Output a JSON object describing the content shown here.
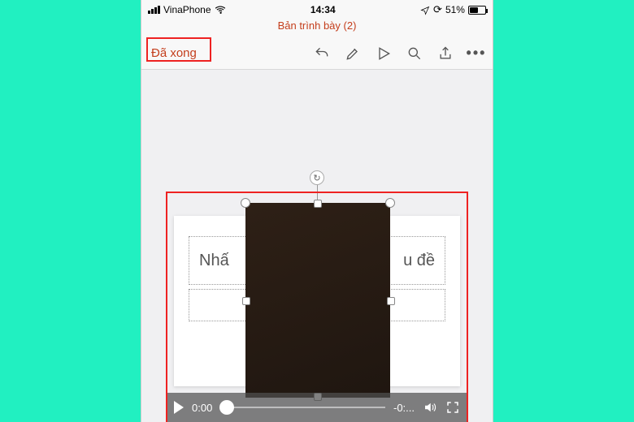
{
  "statusbar": {
    "carrier": "VinaPhone",
    "time": "14:34",
    "battery_text": "51%"
  },
  "titlebar": {
    "title": "Bản trình bày (2)"
  },
  "toolbar": {
    "done_label": "Đã xong"
  },
  "slide": {
    "title_placeholder_visible_left": "Nhấ",
    "title_placeholder_visible_right": "u đề"
  },
  "media": {
    "current_time": "0:00",
    "remaining_time": "-0:..."
  }
}
